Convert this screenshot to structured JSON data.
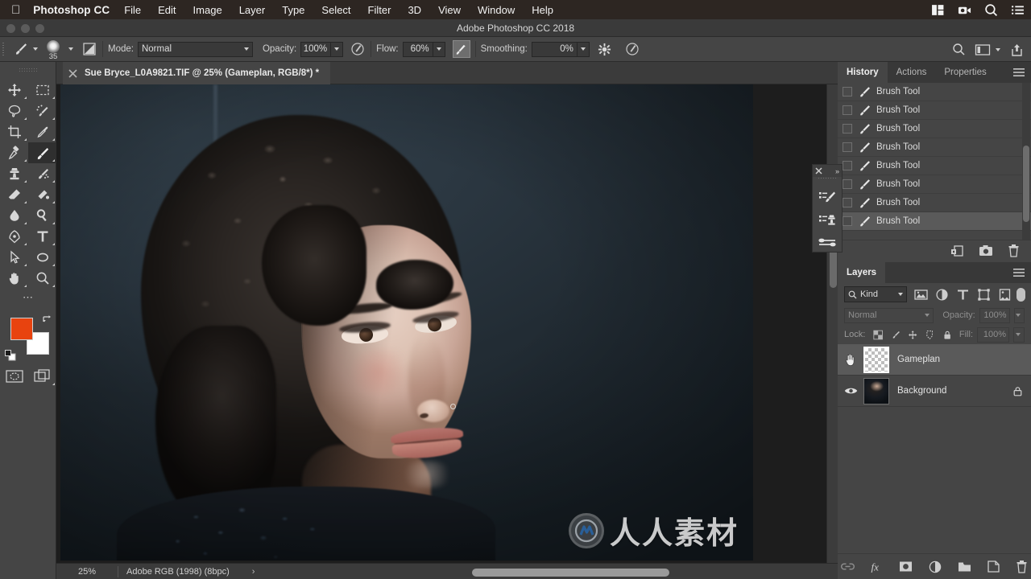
{
  "macbar": {
    "apple": "apple-logo",
    "app_name": "Photoshop CC",
    "menus": [
      "File",
      "Edit",
      "Image",
      "Layer",
      "Type",
      "Select",
      "Filter",
      "3D",
      "View",
      "Window",
      "Help"
    ],
    "right_icons": [
      "control-center-icon",
      "screen-record-icon",
      "spotlight-search-icon",
      "siri-list-icon"
    ]
  },
  "titlebar": {
    "title": "Adobe Photoshop CC 2018"
  },
  "options": {
    "tool_icon": "brush-tool-icon",
    "brush_size": "35",
    "mode_label": "Mode:",
    "mode_value": "Normal",
    "opacity_label": "Opacity:",
    "opacity_value": "100%",
    "flow_label": "Flow:",
    "flow_value": "60%",
    "smoothing_label": "Smoothing:",
    "smoothing_value": "0%",
    "airbrush_icon": "airbrush-icon",
    "pressure_opacity_icon": "pressure-opacity-icon",
    "pressure_size_icon": "pressure-size-icon",
    "settings_icon": "gear-icon",
    "right_icons": [
      "search-icon",
      "workspace-icon",
      "share-icon"
    ]
  },
  "tools": [
    {
      "name": "move-tool",
      "row": 0,
      "col": 0
    },
    {
      "name": "rectangular-marquee-tool",
      "row": 0,
      "col": 1
    },
    {
      "name": "lasso-tool",
      "row": 1,
      "col": 0
    },
    {
      "name": "quick-selection-tool",
      "row": 1,
      "col": 1
    },
    {
      "name": "crop-tool",
      "row": 2,
      "col": 0
    },
    {
      "name": "eyedropper-tool",
      "row": 2,
      "col": 1
    },
    {
      "name": "healing-brush-tool",
      "row": 3,
      "col": 0
    },
    {
      "name": "brush-tool",
      "row": 3,
      "col": 1,
      "active": true
    },
    {
      "name": "clone-stamp-tool",
      "row": 4,
      "col": 0
    },
    {
      "name": "history-brush-tool",
      "row": 4,
      "col": 1
    },
    {
      "name": "eraser-tool",
      "row": 5,
      "col": 0
    },
    {
      "name": "gradient-tool",
      "row": 5,
      "col": 1
    },
    {
      "name": "blur-tool",
      "row": 6,
      "col": 0
    },
    {
      "name": "dodge-tool",
      "row": 6,
      "col": 1
    },
    {
      "name": "pen-tool",
      "row": 7,
      "col": 0
    },
    {
      "name": "type-tool",
      "row": 7,
      "col": 1
    },
    {
      "name": "path-selection-tool",
      "row": 8,
      "col": 0
    },
    {
      "name": "ellipse-tool",
      "row": 8,
      "col": 1
    },
    {
      "name": "hand-tool",
      "row": 9,
      "col": 0
    },
    {
      "name": "zoom-tool",
      "row": 9,
      "col": 1
    }
  ],
  "colors": {
    "foreground": "#e8430f",
    "background": "#ffffff",
    "swap_icon": "swap-colors-icon",
    "default_icon": "default-colors-icon"
  },
  "quickmask": [
    "quick-mask-icon",
    "screen-mode-icon"
  ],
  "document": {
    "tab_title": "Sue Bryce_L0A9821.TIF @ 25% (Gameplan, RGB/8*) *",
    "close_icon": "close-icon"
  },
  "statusbar": {
    "zoom": "25%",
    "profile": "Adobe RGB (1998) (8bpc)",
    "arrow": "›"
  },
  "watermark": {
    "text": "人人素材",
    "logo": "watermark-logo"
  },
  "history_panel": {
    "tabs": [
      {
        "label": "History",
        "active": true
      },
      {
        "label": "Actions",
        "active": false
      },
      {
        "label": "Properties",
        "active": false
      }
    ],
    "menu_icon": "panel-menu-icon",
    "items": [
      {
        "label": "Brush Tool",
        "icon": "brush-tool-icon",
        "selected": false
      },
      {
        "label": "Brush Tool",
        "icon": "brush-tool-icon",
        "selected": false
      },
      {
        "label": "Brush Tool",
        "icon": "brush-tool-icon",
        "selected": false
      },
      {
        "label": "Brush Tool",
        "icon": "brush-tool-icon",
        "selected": false
      },
      {
        "label": "Brush Tool",
        "icon": "brush-tool-icon",
        "selected": false
      },
      {
        "label": "Brush Tool",
        "icon": "brush-tool-icon",
        "selected": false
      },
      {
        "label": "Brush Tool",
        "icon": "brush-tool-icon",
        "selected": false
      },
      {
        "label": "Brush Tool",
        "icon": "brush-tool-icon",
        "selected": true
      }
    ],
    "footer_icons": [
      "create-document-from-state-icon",
      "create-snapshot-icon",
      "delete-icon"
    ]
  },
  "layers_panel": {
    "tabs": [
      {
        "label": "Layers",
        "active": true
      }
    ],
    "menu_icon": "panel-menu-icon",
    "filter": {
      "kind_label": "Kind",
      "search_icon": "search-icon",
      "icons": [
        "filter-pixel-icon",
        "filter-adjustment-icon",
        "filter-type-icon",
        "filter-shape-icon",
        "filter-smart-object-icon"
      ],
      "toggle": "filter-toggle-switch"
    },
    "blend_mode": "Normal",
    "opacity_label": "Opacity:",
    "opacity_value": "100%",
    "lock_label": "Lock:",
    "lock_icons": [
      "lock-transparent-pixels-icon",
      "lock-image-pixels-icon",
      "lock-position-icon",
      "lock-artboard-icon",
      "lock-all-icon"
    ],
    "fill_label": "Fill:",
    "fill_value": "100%",
    "layers": [
      {
        "name": "Gameplan",
        "selected": true,
        "visible": false,
        "thumb": "transparent",
        "locked": false,
        "vis_icon": "hand-cursor-icon"
      },
      {
        "name": "Background",
        "selected": false,
        "visible": true,
        "thumb": "photo",
        "locked": true,
        "vis_icon": "eye-icon"
      }
    ],
    "footer_icons": [
      "link-layers-icon",
      "layer-style-fx-icon",
      "add-layer-mask-icon",
      "new-adjustment-layer-icon",
      "new-group-icon",
      "new-layer-icon",
      "delete-layer-icon"
    ]
  },
  "mini_panel": {
    "close_icon": "close-icon",
    "expand_icon": "expand-panel-icon",
    "buttons": [
      "brush-presets-icon",
      "clone-source-icon",
      "brush-settings-icon"
    ]
  }
}
